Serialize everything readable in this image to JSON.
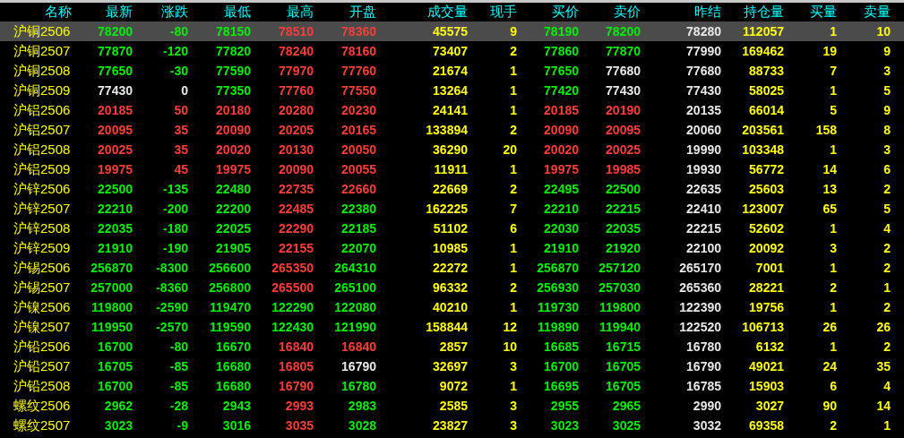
{
  "table": {
    "columns": [
      "名称",
      "最新",
      "涨跌",
      "最低",
      "最高",
      "开盘",
      "成交量",
      "现手",
      "买价",
      "卖价",
      "昨结",
      "持仓量",
      "买量",
      "卖量"
    ],
    "rows": [
      {
        "selected": true,
        "cells": [
          "沪铜2506",
          "78200",
          "-80",
          "78150",
          "78510",
          "78360",
          "45575",
          "9",
          "78190",
          "78200",
          "78280",
          "112057",
          "1",
          "10"
        ]
      },
      {
        "selected": false,
        "cells": [
          "沪铜2507",
          "77870",
          "-120",
          "77820",
          "78240",
          "78160",
          "73407",
          "2",
          "77860",
          "77870",
          "77990",
          "169462",
          "19",
          "9"
        ]
      },
      {
        "selected": false,
        "cells": [
          "沪铜2508",
          "77650",
          "-30",
          "77590",
          "77970",
          "77760",
          "21674",
          "1",
          "77650",
          "77680",
          "77680",
          "88733",
          "7",
          "3"
        ]
      },
      {
        "selected": false,
        "cells": [
          "沪铜2509",
          "77430",
          "0",
          "77350",
          "77760",
          "77550",
          "13264",
          "1",
          "77420",
          "77430",
          "77430",
          "58025",
          "1",
          "5"
        ]
      },
      {
        "selected": false,
        "cells": [
          "沪铝2506",
          "20185",
          "50",
          "20180",
          "20280",
          "20230",
          "24141",
          "1",
          "20185",
          "20190",
          "20135",
          "66014",
          "5",
          "9"
        ]
      },
      {
        "selected": false,
        "cells": [
          "沪铝2507",
          "20095",
          "35",
          "20090",
          "20205",
          "20165",
          "133894",
          "2",
          "20090",
          "20095",
          "20060",
          "203561",
          "158",
          "8"
        ]
      },
      {
        "selected": false,
        "cells": [
          "沪铝2508",
          "20025",
          "35",
          "20020",
          "20130",
          "20050",
          "36290",
          "20",
          "20020",
          "20025",
          "19990",
          "103348",
          "1",
          "3"
        ]
      },
      {
        "selected": false,
        "cells": [
          "沪铝2509",
          "19975",
          "45",
          "19975",
          "20090",
          "20055",
          "11911",
          "1",
          "19975",
          "19985",
          "19930",
          "56772",
          "14",
          "6"
        ]
      },
      {
        "selected": false,
        "cells": [
          "沪锌2506",
          "22500",
          "-135",
          "22480",
          "22735",
          "22660",
          "22669",
          "2",
          "22495",
          "22500",
          "22635",
          "25603",
          "13",
          "2"
        ]
      },
      {
        "selected": false,
        "cells": [
          "沪锌2507",
          "22210",
          "-200",
          "22200",
          "22485",
          "22380",
          "162225",
          "7",
          "22210",
          "22215",
          "22410",
          "123007",
          "65",
          "5"
        ]
      },
      {
        "selected": false,
        "cells": [
          "沪锌2508",
          "22035",
          "-180",
          "22025",
          "22290",
          "22185",
          "51102",
          "6",
          "22030",
          "22035",
          "22215",
          "52602",
          "1",
          "4"
        ]
      },
      {
        "selected": false,
        "cells": [
          "沪锌2509",
          "21910",
          "-190",
          "21905",
          "22155",
          "22070",
          "10985",
          "1",
          "21910",
          "21920",
          "22100",
          "20092",
          "3",
          "2"
        ]
      },
      {
        "selected": false,
        "cells": [
          "沪锡2506",
          "256870",
          "-8300",
          "256600",
          "265350",
          "264310",
          "22272",
          "1",
          "256870",
          "257120",
          "265170",
          "7001",
          "1",
          "2"
        ]
      },
      {
        "selected": false,
        "cells": [
          "沪锡2507",
          "257000",
          "-8360",
          "256800",
          "265500",
          "265100",
          "96332",
          "2",
          "256930",
          "257030",
          "265360",
          "28221",
          "2",
          "1"
        ]
      },
      {
        "selected": false,
        "cells": [
          "沪镍2506",
          "119800",
          "-2590",
          "119470",
          "122290",
          "122080",
          "40210",
          "1",
          "119730",
          "119800",
          "122390",
          "19756",
          "1",
          "2"
        ]
      },
      {
        "selected": false,
        "cells": [
          "沪镍2507",
          "119950",
          "-2570",
          "119590",
          "122430",
          "121990",
          "158844",
          "12",
          "119890",
          "119940",
          "122520",
          "106713",
          "26",
          "26"
        ]
      },
      {
        "selected": false,
        "cells": [
          "沪铅2506",
          "16700",
          "-80",
          "16670",
          "16840",
          "16840",
          "2857",
          "10",
          "16685",
          "16715",
          "16780",
          "6132",
          "1",
          "2"
        ]
      },
      {
        "selected": false,
        "cells": [
          "沪铅2507",
          "16705",
          "-85",
          "16680",
          "16805",
          "16790",
          "32697",
          "3",
          "16700",
          "16705",
          "16790",
          "49021",
          "24",
          "35"
        ]
      },
      {
        "selected": false,
        "cells": [
          "沪铅2508",
          "16700",
          "-85",
          "16680",
          "16790",
          "16780",
          "9072",
          "1",
          "16695",
          "16705",
          "16785",
          "15903",
          "6",
          "4"
        ]
      },
      {
        "selected": false,
        "cells": [
          "螺纹2506",
          "2962",
          "-28",
          "2943",
          "2993",
          "2983",
          "2585",
          "3",
          "2955",
          "2965",
          "2990",
          "3027",
          "90",
          "14"
        ]
      },
      {
        "selected": false,
        "cells": [
          "螺纹2507",
          "3023",
          "-9",
          "3016",
          "3035",
          "3028",
          "23827",
          "3",
          "3023",
          "3025",
          "3032",
          "69358",
          "2",
          "1"
        ]
      }
    ]
  }
}
